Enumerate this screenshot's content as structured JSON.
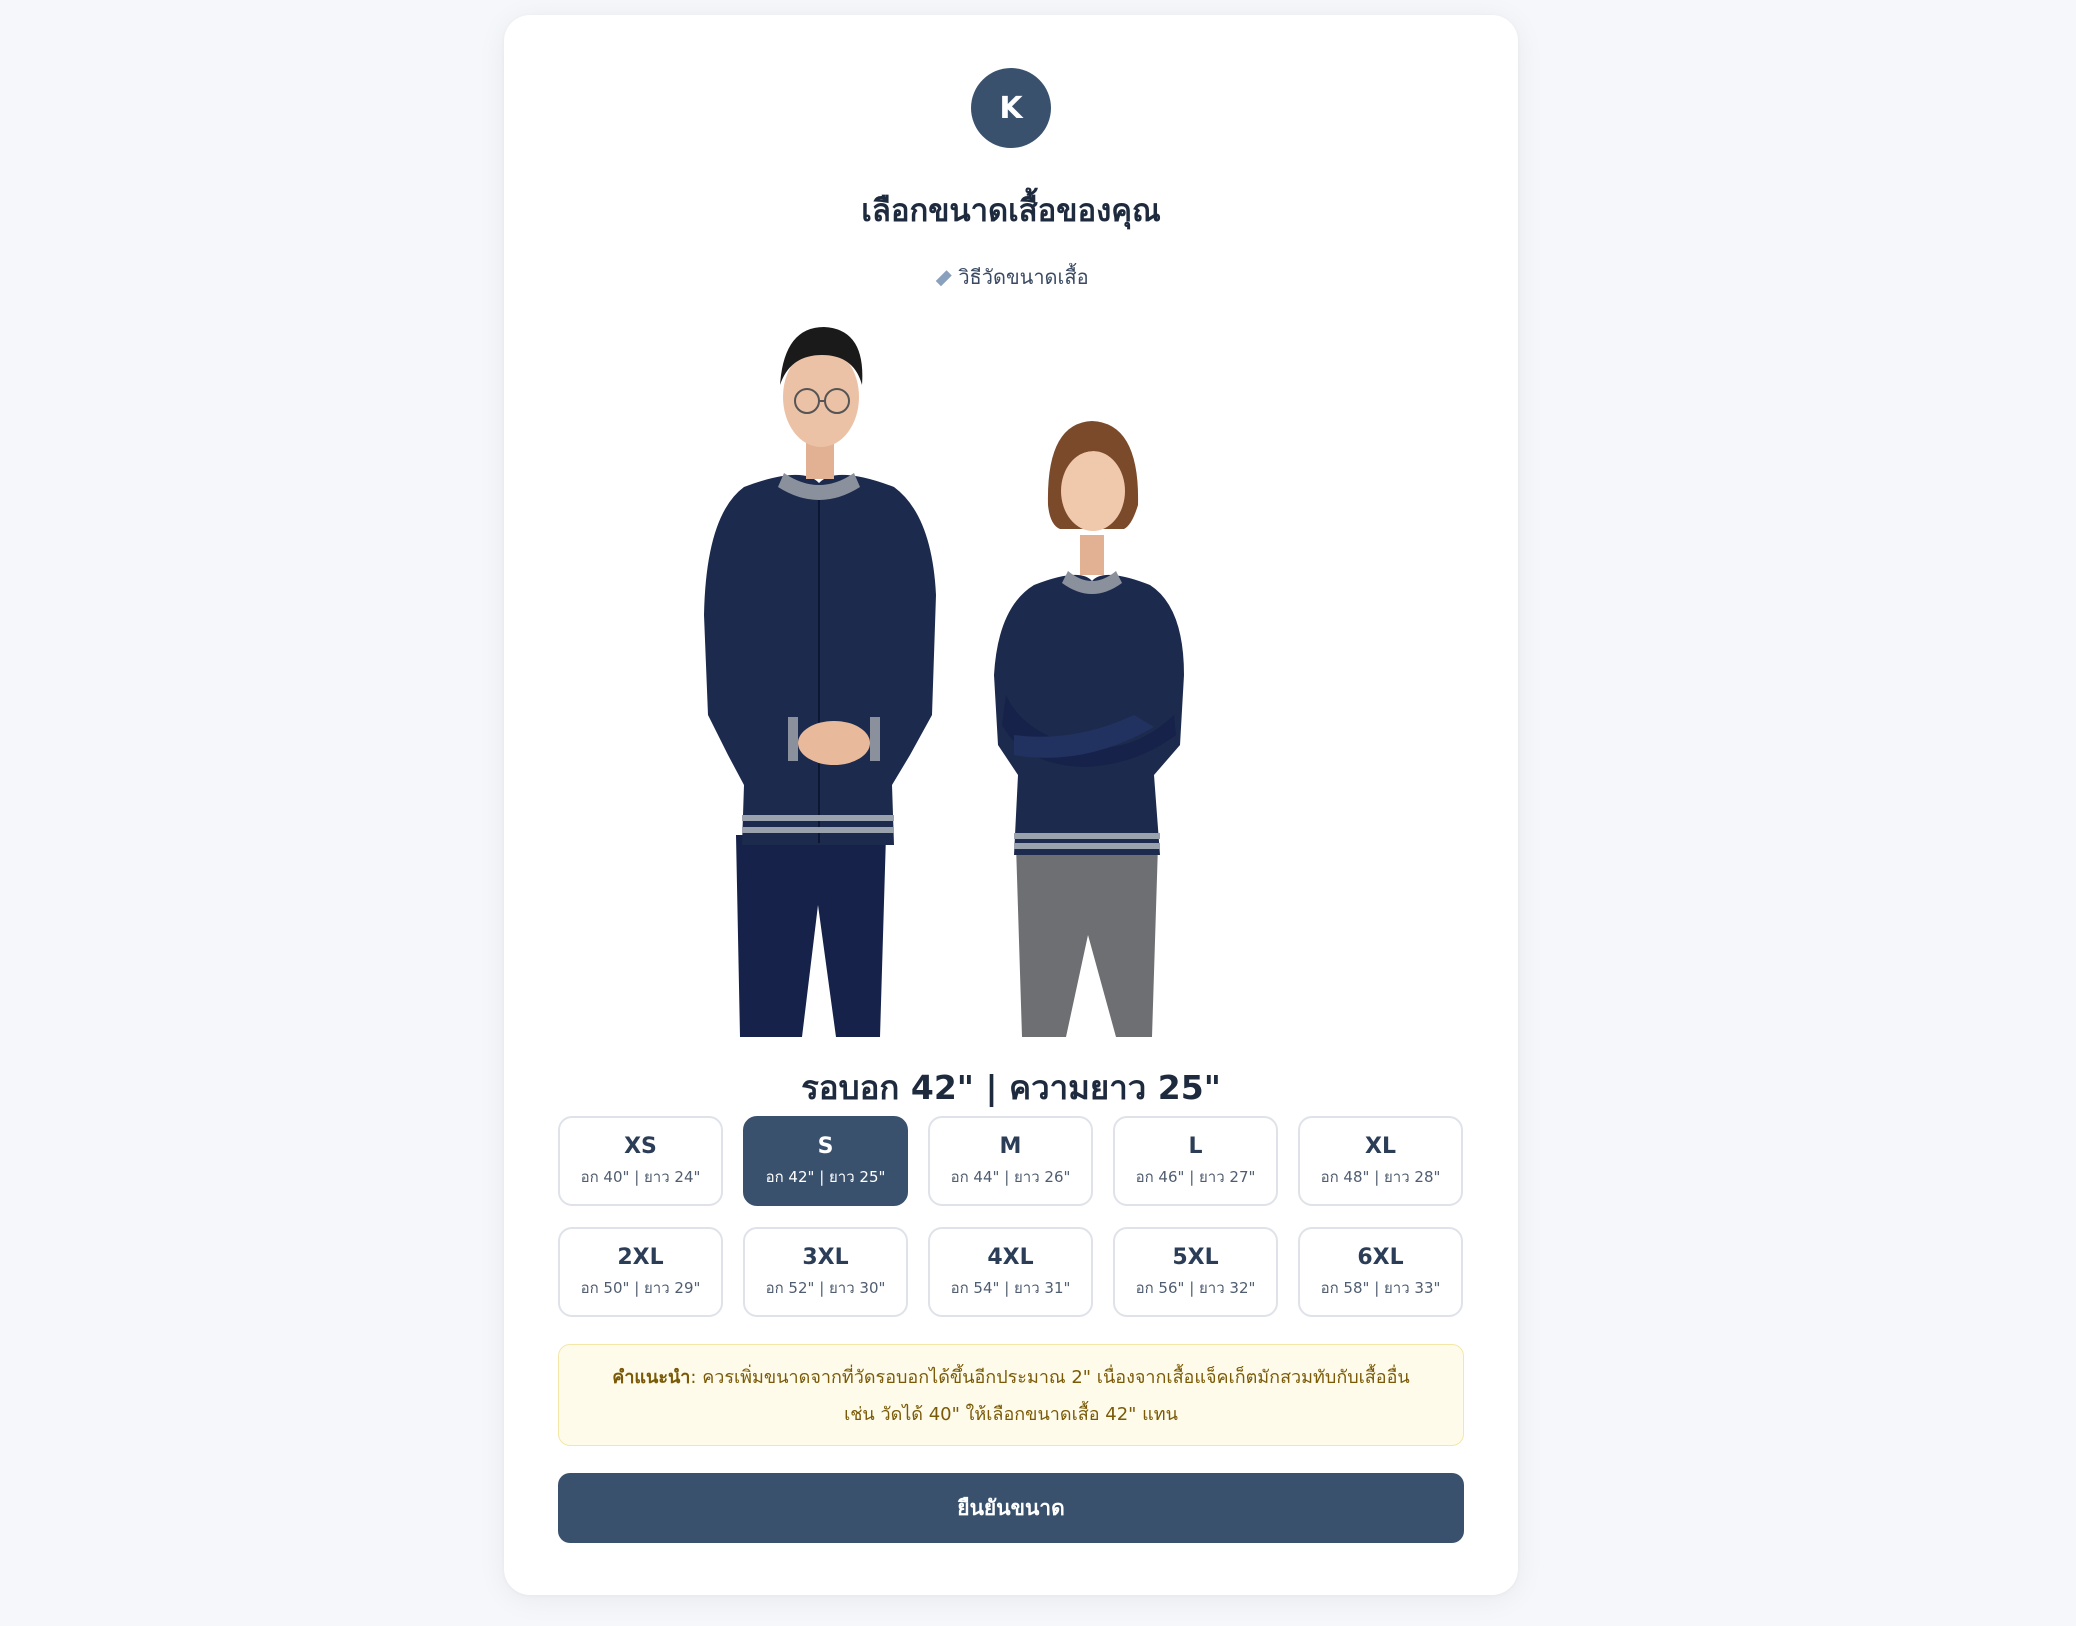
{
  "header": {
    "avatar_letter": "K",
    "title": "เลือกขนาดเสื้อของคุณ",
    "measure_link": "วิธีวัดขนาดเสื้อ",
    "measure_icon": "ruler-icon"
  },
  "selected_display": "รอบอก 42\" | ความยาว 25\"",
  "sizes": [
    {
      "size": "XS",
      "dims": "อก 40\" | ยาว 24\""
    },
    {
      "size": "S",
      "dims": "อก 42\" | ยาว 25\""
    },
    {
      "size": "M",
      "dims": "อก 44\" | ยาว 26\""
    },
    {
      "size": "L",
      "dims": "อก 46\" | ยาว 27\""
    },
    {
      "size": "XL",
      "dims": "อก 48\" | ยาว 28\""
    },
    {
      "size": "2XL",
      "dims": "อก 50\" | ยาว 29\""
    },
    {
      "size": "3XL",
      "dims": "อก 52\" | ยาว 30\""
    },
    {
      "size": "4XL",
      "dims": "อก 54\" | ยาว 31\""
    },
    {
      "size": "5XL",
      "dims": "อก 56\" | ยาว 32\""
    },
    {
      "size": "6XL",
      "dims": "อก 58\" | ยาว 33\""
    }
  ],
  "selected_size": "S",
  "tip": {
    "label": "คำแนะนำ",
    "line1": ": ควรเพิ่มขนาดจากที่วัดรอบอกได้ขึ้นอีกประมาณ 2\" เนื่องจากเสื้อแจ็คเก็ตมักสวมทับกับเสื้ออื่น",
    "line2": "เช่น วัดได้ 40\" ให้เลือกขนาดเสื้อ 42\" แทน"
  },
  "confirm_label": "ยืนยันขนาด",
  "colors": {
    "primary": "#3a516e",
    "jacket": "#1c2a4d",
    "tip_bg": "#fefbea",
    "tip_text": "#7a5a07"
  }
}
